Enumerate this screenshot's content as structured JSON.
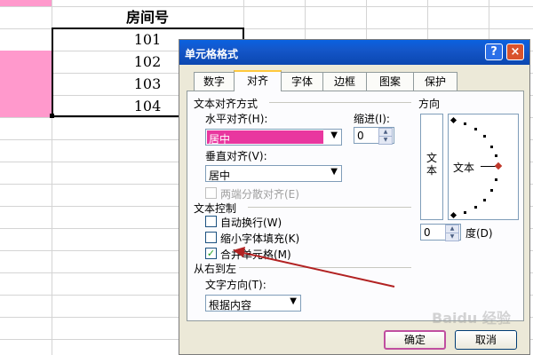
{
  "sheet": {
    "header": "房间号",
    "rooms": [
      "101",
      "102",
      "103",
      "104"
    ]
  },
  "dialog": {
    "title": "单元格格式",
    "help_glyph": "?",
    "close_glyph": "×",
    "tabs": [
      "数字",
      "对齐",
      "字体",
      "边框",
      "图案",
      "保护"
    ],
    "active_tab": "对齐",
    "text_align_group": "文本对齐方式",
    "horizontal_label": "水平对齐(H):",
    "horizontal_value": "居中",
    "indent_label": "缩进(I):",
    "indent_value": "0",
    "vertical_label": "垂直对齐(V):",
    "vertical_value": "居中",
    "distributed_label": "两端分散对齐(E)",
    "text_control_group": "文本控制",
    "wrap_label": "自动换行(W)",
    "shrink_label": "缩小字体填充(K)",
    "merge_label": "合并单元格(M)",
    "merge_checked": true,
    "rtl_group": "从右到左",
    "direction_label": "文字方向(T):",
    "direction_value": "根据内容",
    "orientation_group": "方向",
    "vertical_text": "文本",
    "dial_text": "文本",
    "degree_value": "0",
    "degree_label": "度(D)",
    "ok_label": "确定",
    "cancel_label": "取消"
  },
  "colors": {
    "selection_pink": "#ff99cc",
    "highlight_magenta": "#e9379f",
    "annotation_arrow": "#b22222"
  },
  "watermark": "Baidu 经验"
}
